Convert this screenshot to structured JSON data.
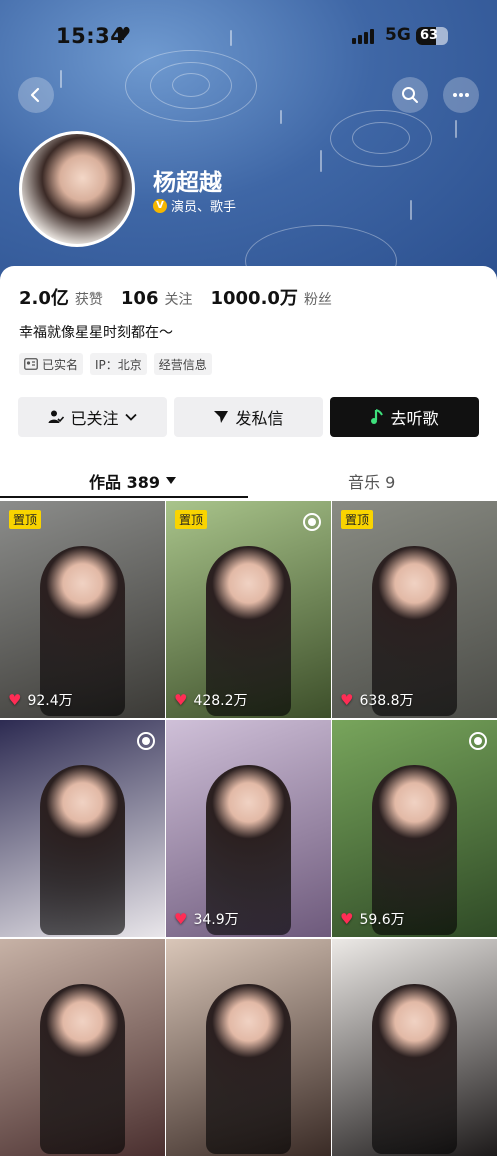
{
  "status_bar": {
    "time": "15:34",
    "network": "5G",
    "battery": "63",
    "battery_level": 0.63
  },
  "profile": {
    "name": "杨超越",
    "verified_badge": "V",
    "verified_text": "演员、歌手",
    "stats": [
      {
        "value": "2.0亿",
        "label": "获赞"
      },
      {
        "value": "106",
        "label": "关注"
      },
      {
        "value": "1000.0万",
        "label": "粉丝"
      }
    ],
    "bio": "幸福就像星星时刻都在～",
    "tags": [
      {
        "icon": "id-card-icon",
        "label": "已实名"
      },
      {
        "icon": "",
        "label": "IP：北京"
      },
      {
        "icon": "",
        "label": "经营信息"
      }
    ]
  },
  "actions": {
    "follow": "已关注",
    "message": "发私信",
    "listen": "去听歌"
  },
  "tabs": {
    "works": "作品 389",
    "music": "音乐 9"
  },
  "grid": [
    {
      "pinned": true,
      "pin_label": "置顶",
      "likes": "92.4万",
      "live": false,
      "c1": "#8c8d8b",
      "c2": "#3b3a36"
    },
    {
      "pinned": true,
      "pin_label": "置顶",
      "likes": "428.2万",
      "live": true,
      "c1": "#a9c48b",
      "c2": "#3d4f2a"
    },
    {
      "pinned": true,
      "pin_label": "置顶",
      "likes": "638.8万",
      "live": false,
      "c1": "#8a8c84",
      "c2": "#4b4c47"
    },
    {
      "pinned": false,
      "pin_label": "",
      "likes": "",
      "live": true,
      "c1": "#2d2b52",
      "c2": "#e9e6ea"
    },
    {
      "pinned": false,
      "pin_label": "",
      "likes": "34.9万",
      "live": false,
      "c1": "#cfc0d8",
      "c2": "#6e5a7c"
    },
    {
      "pinned": false,
      "pin_label": "",
      "likes": "59.6万",
      "live": true,
      "c1": "#78a55c",
      "c2": "#2f4a26"
    },
    {
      "pinned": false,
      "pin_label": "",
      "likes": "",
      "live": false,
      "c1": "#c7b2a6",
      "c2": "#4a2f2f"
    },
    {
      "pinned": false,
      "pin_label": "",
      "likes": "",
      "live": false,
      "c1": "#d9c6b8",
      "c2": "#3a2b26"
    },
    {
      "pinned": false,
      "pin_label": "",
      "likes": "",
      "live": false,
      "c1": "#ece9e6",
      "c2": "#1d1a1a"
    }
  ]
}
